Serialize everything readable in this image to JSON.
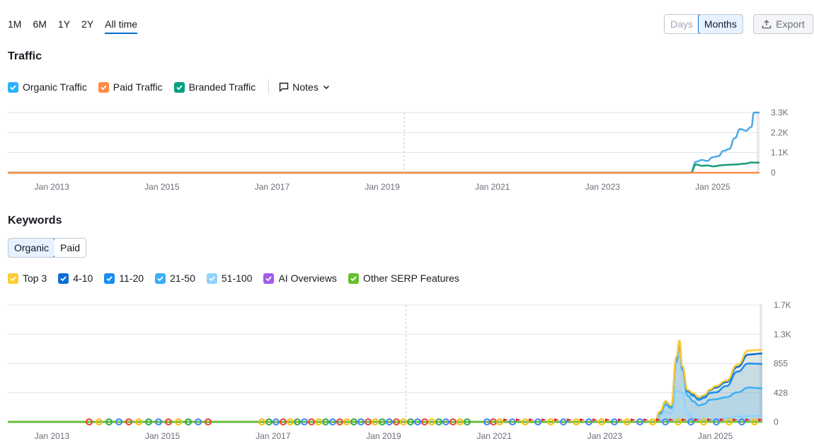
{
  "range_tabs": [
    "1M",
    "6M",
    "1Y",
    "2Y",
    "All time"
  ],
  "active_range": "All time",
  "granularity": {
    "days": "Days",
    "months": "Months",
    "selected": "Months"
  },
  "export_label": "Export",
  "traffic": {
    "title": "Traffic",
    "legend": [
      {
        "label": "Organic Traffic",
        "color": "#2bb3ff",
        "checked": true
      },
      {
        "label": "Paid Traffic",
        "color": "#ff8c43",
        "checked": true
      },
      {
        "label": "Branded Traffic",
        "color": "#009f81",
        "checked": true
      }
    ],
    "notes_label": "Notes"
  },
  "keywords": {
    "title": "Keywords",
    "tabs": [
      "Organic",
      "Paid"
    ],
    "selected_tab": "Organic",
    "legend": [
      {
        "label": "Top 3",
        "color": "#ffcc33",
        "checked": true
      },
      {
        "label": "4-10",
        "color": "#0c6ed0",
        "checked": true
      },
      {
        "label": "11-20",
        "color": "#1a8df0",
        "checked": true
      },
      {
        "label": "21-50",
        "color": "#3bb0f5",
        "checked": true
      },
      {
        "label": "51-100",
        "color": "#8fd3fc",
        "checked": true
      },
      {
        "label": "AI Overviews",
        "color": "#a35eea",
        "checked": true
      },
      {
        "label": "Other SERP Features",
        "color": "#66c02e",
        "checked": true
      }
    ]
  },
  "chart_data": [
    {
      "type": "line",
      "name": "traffic",
      "x_ticks": [
        "Jan 2013",
        "Jan 2015",
        "Jan 2017",
        "Jan 2019",
        "Jan 2021",
        "Jan 2023",
        "Jan 2025"
      ],
      "y_ticks": [
        "0",
        "1.1K",
        "2.2K",
        "3.3K"
      ],
      "ylim": [
        0,
        3300
      ],
      "xlim": [
        2012.2,
        2025.85
      ],
      "x_marker": 2019.4,
      "series": [
        {
          "name": "Organic Traffic",
          "color": "#4aa8e8",
          "x": [
            2012.2,
            2024.6,
            2024.7,
            2024.8,
            2024.9,
            2025.0,
            2025.1,
            2025.2,
            2025.3,
            2025.4,
            2025.5,
            2025.6,
            2025.7,
            2025.75,
            2025.85
          ],
          "y": [
            0,
            0,
            600,
            700,
            650,
            850,
            900,
            1200,
            1300,
            1900,
            2400,
            2300,
            2500,
            3300,
            3300
          ]
        },
        {
          "name": "Branded Traffic",
          "color": "#1a9b7a",
          "x": [
            2012.2,
            2024.6,
            2024.7,
            2024.8,
            2024.9,
            2025.0,
            2025.2,
            2025.4,
            2025.6,
            2025.7,
            2025.85
          ],
          "y": [
            0,
            0,
            450,
            380,
            400,
            350,
            420,
            450,
            500,
            560,
            550
          ]
        },
        {
          "name": "Paid Traffic",
          "color": "#ff8c43",
          "x": [
            2012.2,
            2024.62,
            2025.85
          ],
          "y": [
            0,
            0,
            0
          ]
        }
      ]
    },
    {
      "type": "area",
      "name": "keywords",
      "x_ticks": [
        "Jan 2013",
        "Jan 2015",
        "Jan 2017",
        "Jan 2019",
        "Jan 2021",
        "Jan 2023",
        "Jan 2025"
      ],
      "y_ticks": [
        "0",
        "428",
        "855",
        "1.3K",
        "1.7K"
      ],
      "ylim": [
        0,
        1700
      ],
      "xlim": [
        2012.2,
        2025.85
      ],
      "x_marker": 2019.4,
      "series": [
        {
          "name": "51-100",
          "color": "#8fd3fc",
          "x": [
            2012.2,
            2023.9,
            2024.0,
            2024.1,
            2024.2,
            2024.3,
            2024.4,
            2024.5,
            2024.6,
            2024.7,
            2024.8,
            2024.9,
            2025.0,
            2025.2,
            2025.4,
            2025.85
          ],
          "y": [
            0,
            0,
            80,
            150,
            120,
            460,
            420,
            120,
            60,
            40,
            30,
            30,
            40,
            60,
            80,
            90
          ]
        },
        {
          "name": "21-50",
          "color": "#3bb0f5",
          "x": [
            2012.2,
            2023.9,
            2024.0,
            2024.1,
            2024.2,
            2024.3,
            2024.35,
            2024.4,
            2024.5,
            2024.6,
            2024.7,
            2024.8,
            2024.9,
            2025.0,
            2025.2,
            2025.4,
            2025.6,
            2025.85
          ],
          "y": [
            0,
            0,
            120,
            250,
            200,
            880,
            1130,
            760,
            380,
            300,
            240,
            260,
            320,
            330,
            360,
            430,
            500,
            490
          ]
        },
        {
          "name": "11-20",
          "color": "#1a8df0",
          "x": [
            2012.2,
            2023.9,
            2024.0,
            2024.1,
            2024.2,
            2024.3,
            2024.35,
            2024.4,
            2024.5,
            2024.6,
            2024.7,
            2024.8,
            2024.9,
            2025.0,
            2025.2,
            2025.4,
            2025.6,
            2025.85
          ],
          "y": [
            0,
            0,
            140,
            290,
            230,
            940,
            1170,
            800,
            440,
            380,
            320,
            350,
            420,
            430,
            520,
            730,
            850,
            845
          ]
        },
        {
          "name": "4-10",
          "color": "#0c6ed0",
          "x": [
            2012.2,
            2023.9,
            2024.0,
            2024.1,
            2024.2,
            2024.3,
            2024.35,
            2024.4,
            2024.5,
            2024.6,
            2024.7,
            2024.8,
            2024.9,
            2025.0,
            2025.2,
            2025.4,
            2025.6,
            2025.85
          ],
          "y": [
            0,
            0,
            150,
            300,
            240,
            950,
            1180,
            810,
            460,
            410,
            350,
            380,
            460,
            500,
            580,
            800,
            980,
            995
          ]
        },
        {
          "name": "Top 3",
          "color": "#ffcc33",
          "x": [
            2012.2,
            2023.9,
            2024.0,
            2024.1,
            2024.2,
            2024.3,
            2024.35,
            2024.4,
            2024.5,
            2024.6,
            2024.7,
            2024.8,
            2024.9,
            2025.0,
            2025.2,
            2025.4,
            2025.6,
            2025.85
          ],
          "y": [
            0,
            0,
            150,
            300,
            240,
            950,
            1180,
            810,
            465,
            420,
            360,
            390,
            470,
            520,
            600,
            830,
            1040,
            1050
          ]
        },
        {
          "name": "Other SERP Features",
          "color": "#66c02e",
          "x": [
            2012.2,
            2025.85
          ],
          "y": [
            0,
            0
          ]
        }
      ]
    }
  ]
}
